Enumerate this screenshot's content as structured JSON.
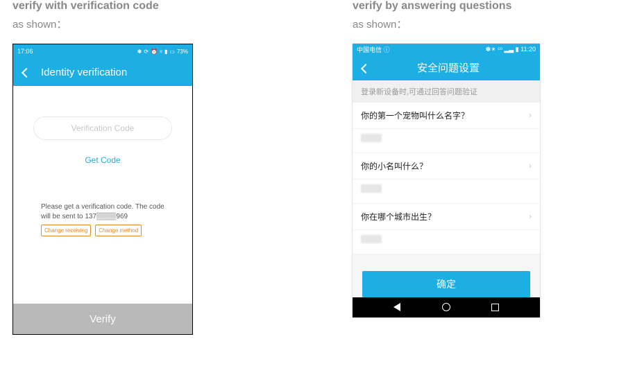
{
  "left": {
    "heading": "verify with verification code",
    "subheading": "as shown：",
    "status": {
      "time": "17:06",
      "battery": "73%"
    },
    "appbar_title": "Identity verification",
    "code_placeholder": "Verification Code",
    "get_code": "Get Code",
    "instruction": "Please get a verification code. The code will be sent to 137▒▒▒▒969",
    "change_receiving": "Change receiving",
    "change_method": "Change method",
    "verify": "Verify"
  },
  "right": {
    "heading": "verify by answering questions",
    "subheading": "as shown：",
    "status": {
      "carrier": "中国电信 ⓘ",
      "right": "✽✴ ᶜᵒ ▂▃ ▮ 11:20"
    },
    "appbar_title": "安全问题设置",
    "info": "登录新设备时,可通过回答问题验证",
    "q1": "你的第一个宠物叫什么名字？",
    "q2": "你的小名叫什么？",
    "q3": "你在哪个城市出生？",
    "confirm": "确定"
  }
}
